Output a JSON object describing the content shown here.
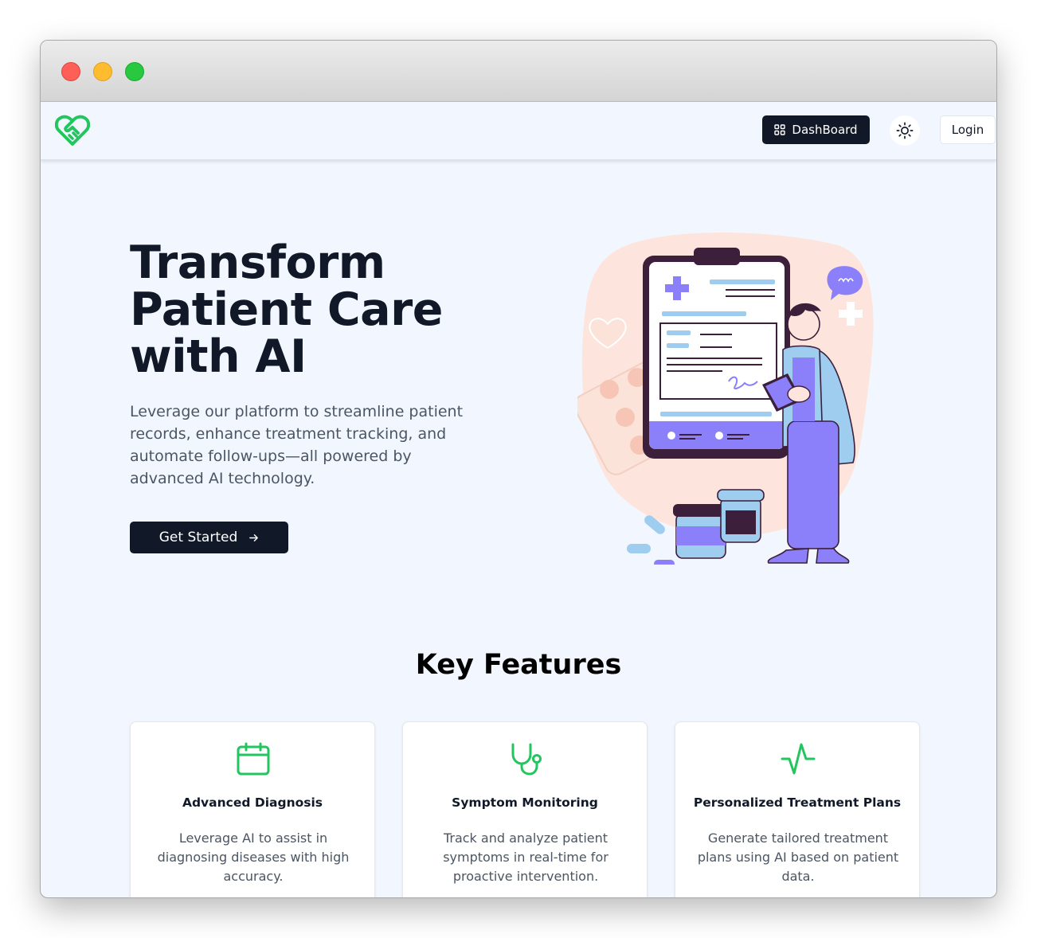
{
  "nav": {
    "dashboard_label": "DashBoard",
    "login_label": "Login"
  },
  "hero": {
    "title_line1": "Transform",
    "title_line2": "Patient Care",
    "title_line3": "with AI",
    "subtitle": "Leverage our platform to streamline patient records, enhance treatment tracking, and automate follow-ups—all powered by advanced AI technology.",
    "cta_label": "Get Started"
  },
  "features": {
    "title": "Key Features",
    "items": [
      {
        "icon": "calendar-icon",
        "title": "Advanced Diagnosis",
        "description": "Leverage AI to assist in diagnosing diseases with high accuracy."
      },
      {
        "icon": "stethoscope-icon",
        "title": "Symptom Monitoring",
        "description": "Track and analyze patient symptoms in real-time for proactive intervention."
      },
      {
        "icon": "activity-icon",
        "title": "Personalized Treatment Plans",
        "description": "Generate tailored treatment plans using AI based on patient data."
      }
    ]
  },
  "colors": {
    "accent_green": "#22c55e",
    "dark": "#111827",
    "background": "#f2f7ff",
    "illustration_purple": "#8b80f9"
  }
}
